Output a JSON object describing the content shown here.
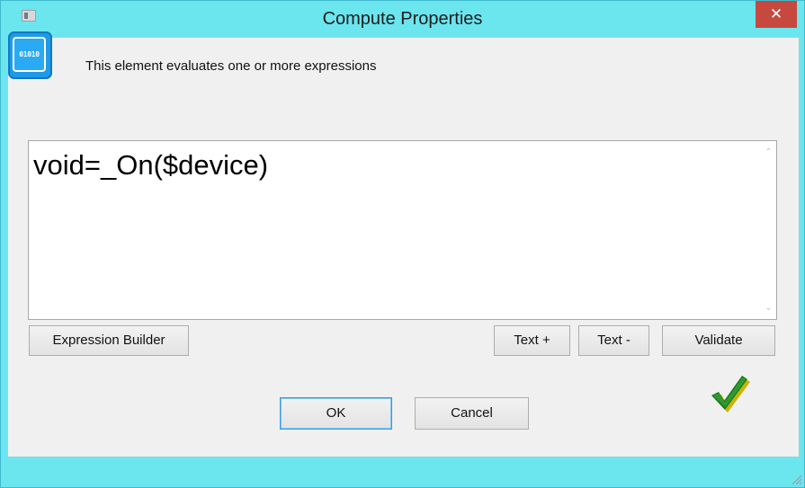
{
  "window": {
    "title": "Compute Properties",
    "close_glyph": "✕",
    "accent_color": "#6be5ee",
    "close_color": "#c7483f"
  },
  "header": {
    "icon_label": "01010",
    "icon_name": "binary-compute-icon",
    "description": "This element evaluates one or more expressions"
  },
  "editor": {
    "expression": "void=_On($device)",
    "scroll_up_glyph": "⌃",
    "scroll_down_glyph": "⌄"
  },
  "toolbar": {
    "expression_builder_label": "Expression Builder",
    "text_plus_label": "Text +",
    "text_minus_label": "Text -",
    "validate_label": "Validate"
  },
  "footer": {
    "ok_label": "OK",
    "cancel_label": "Cancel",
    "status_icon": "green-check-icon"
  }
}
